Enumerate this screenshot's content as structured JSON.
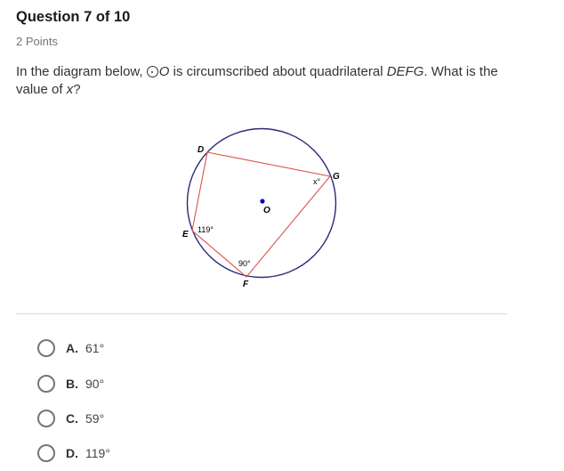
{
  "question": {
    "title": "Question 7 of 10",
    "points": "2 Points",
    "text_part1": "In the diagram below, ",
    "circle_symbol": "circle-dot-icon",
    "circle_name": "O",
    "text_part2": " is circumscribed about quadrilateral ",
    "quad_name": "DEFG",
    "text_part3": ". What is the value of ",
    "variable": "x",
    "text_part4": "?"
  },
  "diagram": {
    "labels": {
      "D": "D",
      "E": "E",
      "F": "F",
      "G": "G",
      "O": "O"
    },
    "angles": {
      "E": "119°",
      "F": "90°",
      "G": "x°"
    },
    "colors": {
      "circle": "#2a2a7a",
      "quadrilateral": "#d9534f",
      "center": "#0000cc"
    }
  },
  "options": [
    {
      "letter": "A.",
      "value": "61°"
    },
    {
      "letter": "B.",
      "value": "90°"
    },
    {
      "letter": "C.",
      "value": "59°"
    },
    {
      "letter": "D.",
      "value": "119°"
    }
  ]
}
